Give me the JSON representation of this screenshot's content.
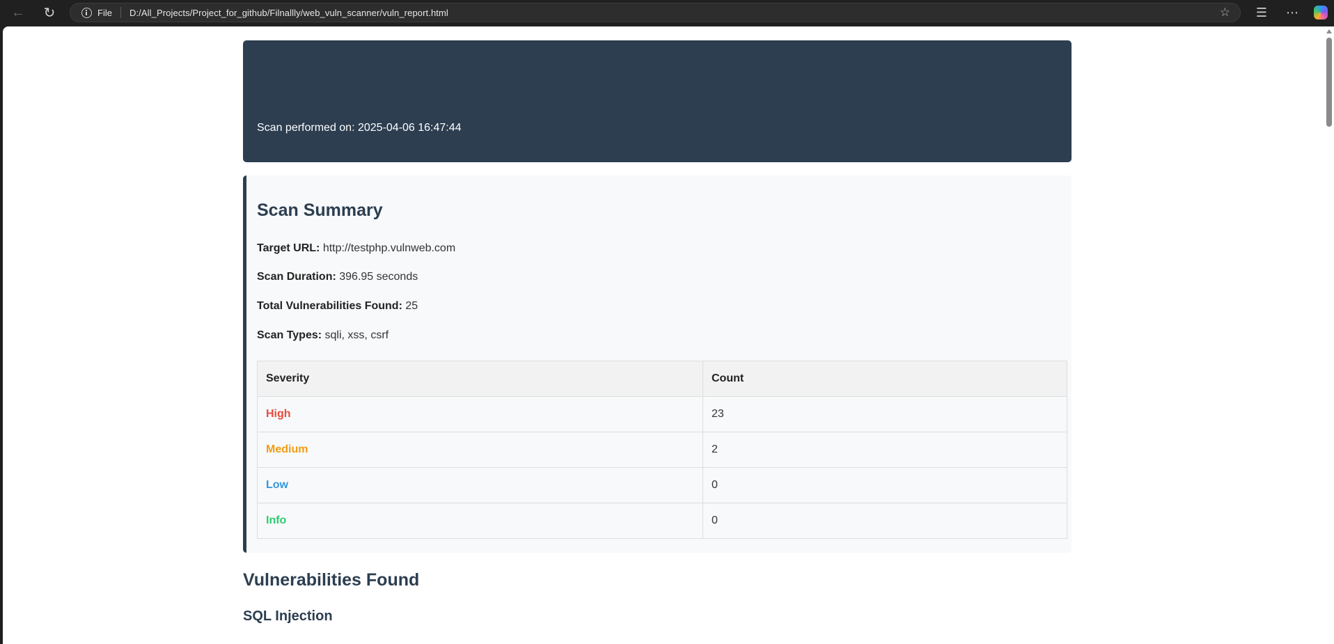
{
  "browser": {
    "file_label": "File",
    "url": "D:/All_Projects/Project_for_github/Filnallly/web_vuln_scanner/vuln_report.html"
  },
  "report": {
    "scan_date_text": "Scan performed on: 2025-04-06 16:47:44",
    "summary": {
      "title": "Scan Summary",
      "target_url_label": "Target URL:",
      "target_url": "http://testphp.vulnweb.com",
      "duration_label": "Scan Duration:",
      "duration": "396.95 seconds",
      "total_label": "Total Vulnerabilities Found:",
      "total": "25",
      "types_label": "Scan Types:",
      "types": "sqli, xss, csrf",
      "table": {
        "headers": [
          "Severity",
          "Count"
        ],
        "rows": [
          {
            "severity": "High",
            "count": "23",
            "color": "#e74c3c"
          },
          {
            "severity": "Medium",
            "count": "2",
            "color": "#f39c12"
          },
          {
            "severity": "Low",
            "count": "0",
            "color": "#3498db"
          },
          {
            "severity": "Info",
            "count": "0",
            "color": "#2ecc71"
          }
        ]
      }
    },
    "vulnerabilities_title": "Vulnerabilities Found",
    "first_category": "SQL Injection"
  },
  "colors": {
    "header_bg": "#2c3e50",
    "summary_bg": "#f7f9fa"
  },
  "icons": [
    "back-arrow-icon",
    "refresh-icon",
    "info-icon",
    "star-icon",
    "favorites-icon",
    "more-icon",
    "copilot-icon"
  ]
}
